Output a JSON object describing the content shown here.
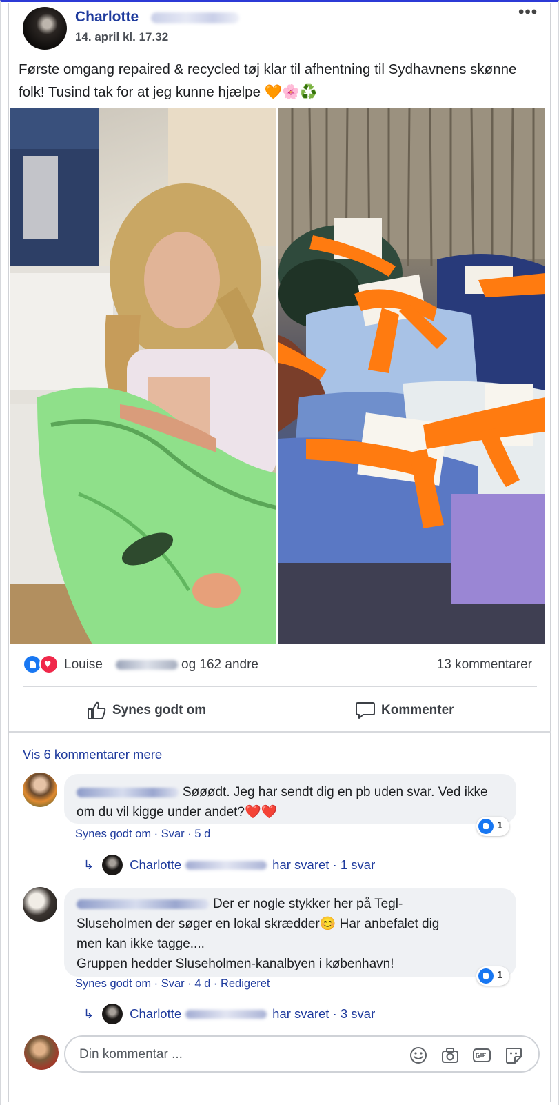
{
  "post": {
    "author": "Charlotte",
    "time": "14. april kl. 17.32",
    "more": "•••",
    "text": "Første omgang repaired & recycled tøj klar til afhentning til Sydhavnens skønne folk! Tusind tak for at jeg kunne hjælpe 🧡🌸♻️"
  },
  "reactions": {
    "first_name": "Louise",
    "rest": "og 162 andre",
    "comments_count": "13 kommentarer"
  },
  "actions": {
    "like": "Synes godt om",
    "comment": "Kommenter"
  },
  "more_comments": "Vis 6 kommentarer mere",
  "comments": [
    {
      "text": "Søøødt. Jeg har sendt dig en pb uden svar. Ved ikke om du vil kigge under andet?❤️❤️",
      "like": "Synes godt om",
      "reply": "Svar",
      "age": "5 d",
      "likes": "1",
      "reply_author": "Charlotte",
      "reply_text": "har svaret · 1 svar"
    },
    {
      "line1": "Der er nogle stykker her på Tegl-",
      "line2": "Sluseholmen der søger en lokal skrædder😊 Har anbefalet dig",
      "line3": "men kan ikke tagge....",
      "line4": "Gruppen hedder Sluseholmen-kanalbyen i københavn!",
      "like": "Synes godt om",
      "reply": "Svar",
      "age": "4 d",
      "edited": "Redigeret",
      "likes": "1",
      "reply_author": "Charlotte",
      "reply_text": "har svaret · 3 svar"
    }
  ],
  "compose": {
    "placeholder": "Din kommentar ..."
  },
  "colors": {
    "link": "#1f3b9d",
    "like_blue": "#1877f2",
    "love_red": "#f0284a",
    "bubble": "#eff1f4"
  }
}
